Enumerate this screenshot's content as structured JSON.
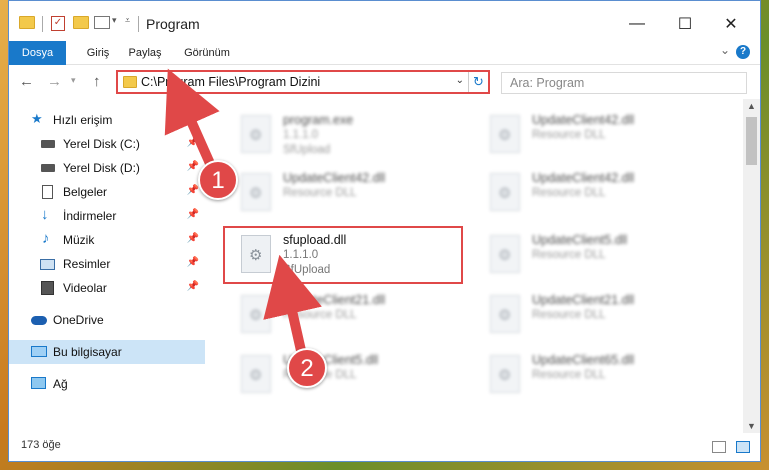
{
  "window": {
    "title": "Program",
    "controls": [
      "—",
      "☐",
      "✕"
    ]
  },
  "ribbon": {
    "tabs": [
      "Dosya",
      "Giriş",
      "Paylaş",
      "Görünüm"
    ],
    "help": "?"
  },
  "address": {
    "path": "C:\\Program Files\\Program Dizini",
    "search_placeholder": "Ara: Program"
  },
  "sidebar": {
    "items": [
      {
        "label": "Hızlı erişim",
        "icon": "star-icon"
      },
      {
        "label": "Yerel Disk (C:)",
        "icon": "drive-icon",
        "pinned": true
      },
      {
        "label": "Yerel Disk (D:)",
        "icon": "drive-icon",
        "pinned": true
      },
      {
        "label": "Belgeler",
        "icon": "documents-icon",
        "pinned": true
      },
      {
        "label": "İndirmeler",
        "icon": "download-icon",
        "pinned": true
      },
      {
        "label": "Müzik",
        "icon": "music-icon",
        "pinned": true
      },
      {
        "label": "Resimler",
        "icon": "pictures-icon",
        "pinned": true
      },
      {
        "label": "Videolar",
        "icon": "videos-icon",
        "pinned": true
      },
      {
        "label": "OneDrive",
        "icon": "cloud-icon"
      },
      {
        "label": "Bu bilgisayar",
        "icon": "computer-icon",
        "selected": true
      },
      {
        "label": "Ağ",
        "icon": "network-icon"
      }
    ]
  },
  "files": [
    {
      "name": "program.exe",
      "line1": "1.1.1.0",
      "line2": "SfUpload"
    },
    {
      "name": "UpdateClient42.dll",
      "line1": "Resource DLL",
      "line2": ""
    },
    {
      "name": "UpdateClient42.dll",
      "line1": "Resource DLL",
      "line2": ""
    },
    {
      "name": "UpdateClient42.dll",
      "line1": "Resource DLL",
      "line2": ""
    },
    {
      "name": "sfupload.dll",
      "line1": "1.1.1.0",
      "line2": "SfUpload"
    },
    {
      "name": "UpdateClient5.dll",
      "line1": "Resource DLL",
      "line2": ""
    },
    {
      "name": "UpdateClient21.dll",
      "line1": "Resource DLL",
      "line2": ""
    },
    {
      "name": "UpdateClient21.dll",
      "line1": "Resource DLL",
      "line2": ""
    },
    {
      "name": "UpdateClient5.dll",
      "line1": "Resource DLL",
      "line2": ""
    },
    {
      "name": "UpdateClient65.dll",
      "line1": "Resource DLL",
      "line2": ""
    }
  ],
  "status": {
    "item_count": "173 öğe"
  },
  "annotations": {
    "step1": "1",
    "step2": "2",
    "color": "#e04848"
  }
}
